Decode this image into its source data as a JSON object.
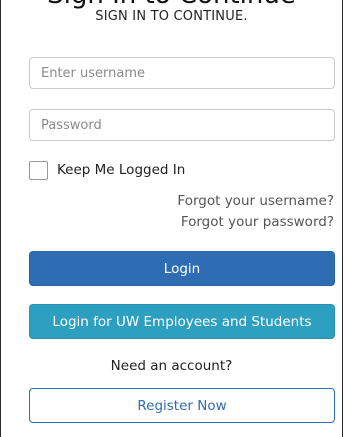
{
  "form": {
    "top_title": "Sign In to Continue",
    "heading": "SIGN IN TO CONTINUE.",
    "username_placeholder": "Enter username",
    "password_placeholder": "Password",
    "remember_label": "Keep Me Logged In",
    "forgot_username": "Forgot your username?",
    "forgot_password": "Forgot your password?",
    "login_label": "Login",
    "uw_login_label": "Login for UW Employees and Students",
    "need_account": "Need an account?",
    "register_label": "Register Now"
  },
  "colors": {
    "login_button": "#2e6db4",
    "uw_button": "#2d9fc0",
    "register_border": "#2e6db4"
  }
}
